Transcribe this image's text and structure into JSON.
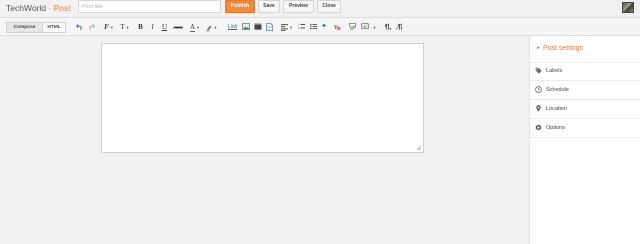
{
  "header": {
    "blog_name": "TechWorld",
    "separator": "·",
    "page_name": "Post",
    "title_placeholder": "Post title",
    "publish_label": "Publish",
    "save_label": "Save",
    "preview_label": "Preview",
    "close_label": "Close"
  },
  "toolbar": {
    "compose_label": "Compose",
    "html_label": "HTML",
    "undo_icon": "undo-icon",
    "redo_icon": "redo-icon",
    "font_glyph": "F",
    "font_size_glyph": "T",
    "bold_glyph": "B",
    "italic_glyph": "I",
    "underline_glyph": "U",
    "strikethrough_glyph": "ABC",
    "text_color_glyph": "A",
    "link_label": "Link",
    "quote_glyph": "❝"
  },
  "editor": {
    "content": ""
  },
  "sidebar": {
    "title": "Post settings",
    "items": [
      {
        "label": "Labels",
        "icon": "tag-icon"
      },
      {
        "label": "Schedule",
        "icon": "clock-icon"
      },
      {
        "label": "Location",
        "icon": "location-pin-icon"
      },
      {
        "label": "Options",
        "icon": "gear-icon"
      }
    ]
  },
  "colors": {
    "accent": "#e8793a",
    "publish_button": "#ef8a3d",
    "background": "#f1f1f1"
  }
}
